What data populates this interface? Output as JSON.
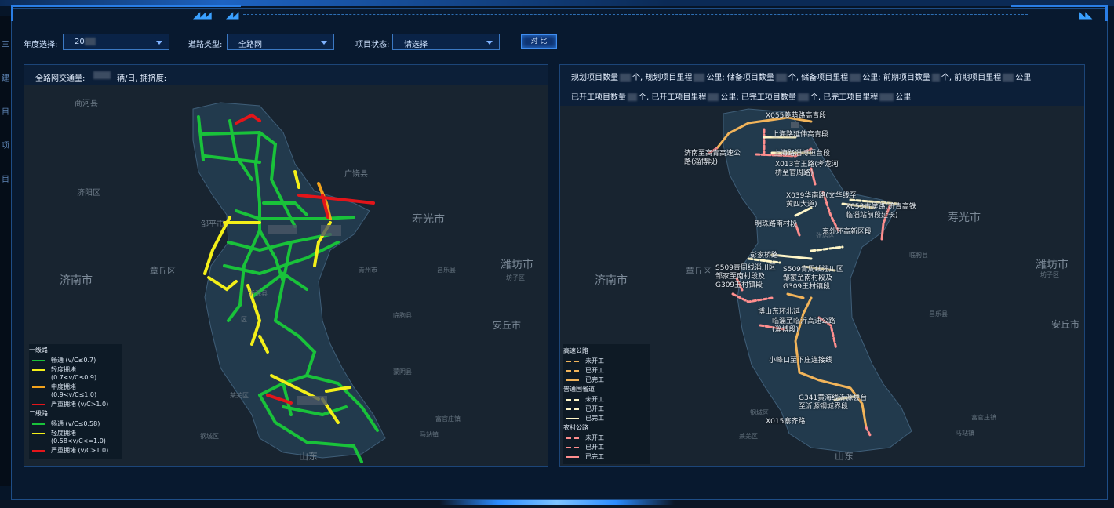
{
  "filters": {
    "year_label": "年度选择:",
    "year_value": "20",
    "road_type_label": "道路类型:",
    "road_type_value": "全路网",
    "status_label": "项目状态:",
    "status_value": "请选择",
    "compare_button": "对 比"
  },
  "left_panel": {
    "header_prefix": "全路网交通量:",
    "header_suffix": "辆/日, 拥挤度:",
    "map_labels": {
      "cities": [
        "济南市",
        "寿光市",
        "潍坊市",
        "安丘市",
        "章丘区"
      ],
      "towns": [
        "商河县",
        "济阳区",
        "邹平市",
        "广饶县",
        "青州市",
        "昌乐县",
        "临朐县",
        "莱芜区",
        "钢城区",
        "沂源县",
        "蒙阴县",
        "马站镇",
        "富官庄镇",
        "山东",
        "坊子区",
        "区"
      ]
    },
    "legend": {
      "group1": "一级路",
      "group1_items": [
        "畅通 (v/C≤0.7)",
        "轻度拥堵 (0.7<v/C≤0.9)",
        "中度拥堵 (0.9<v/C≤1.0)",
        "严重拥堵 (v/C>1.0)"
      ],
      "group2": "二级路",
      "group2_items": [
        "畅通 (v/C≤0.58)",
        "轻度拥堵 (0.58<v/C<=1.0)",
        "严重拥堵 (v/C>1.0)"
      ]
    },
    "colors": {
      "smooth": "#19c23a",
      "light": "#f3ef19",
      "medium": "#f2a21c",
      "severe": "#e3151a"
    }
  },
  "right_panel": {
    "header_line1": [
      "规划项目数量",
      "个, 规划项目里程",
      "公里; 储备项目数量",
      "个, 储备项目里程",
      "公里; 前期项目数量",
      "个, 前期项目里程",
      "公里"
    ],
    "header_line2": [
      "已开工项目数量",
      "个, 已开工项目里程",
      "公里; 已完工项目数量",
      "个, 已完工项目里程",
      "公里"
    ],
    "map_labels": {
      "cities": [
        "济南市",
        "寿光市",
        "潍坊市",
        "安丘市",
        "章丘区"
      ],
      "towns": [
        "张店区",
        "山东",
        "昌乐县",
        "临朐县",
        "莱芜区",
        "钢城区",
        "坊子区",
        "马站镇",
        "富官庄镇"
      ],
      "roads": [
        "X055姜萌路高青段",
        "上海路延伸高青段",
        "上海路淄博桓台段",
        "X013官王路(孝龙河桥至官周路)",
        "济南至高青高速公路(淄博段)",
        "X039华南路(文华线至黄四大道)",
        "X053古侯路(济青高铁临淄站前段延长)",
        "明珠路南村段",
        "东外环高新区段",
        "彭家桥路",
        "S509青周线淄川区邹家至南村段及G309王村镇段",
        "S509青周线淄川区邹家至南村段及G309王村镇段",
        "博山东环北延",
        "临淄至临沂高速公路(淄博段)",
        "小峰口至下庄连接线",
        "G341黄海线沂源县台至沂源钢城界段",
        "X015寨齐路"
      ]
    },
    "legend": {
      "group1": "高速公路",
      "group2": "普通国省道",
      "group3": "农村公路",
      "items": [
        "未开工",
        "已开工",
        "已完工"
      ]
    },
    "colors": {
      "highway": "#f2b45a",
      "national": "#fff6c8",
      "rural": "#ff8e8e"
    }
  },
  "left_strip": [
    "三",
    "建",
    "目",
    "项",
    "目"
  ]
}
